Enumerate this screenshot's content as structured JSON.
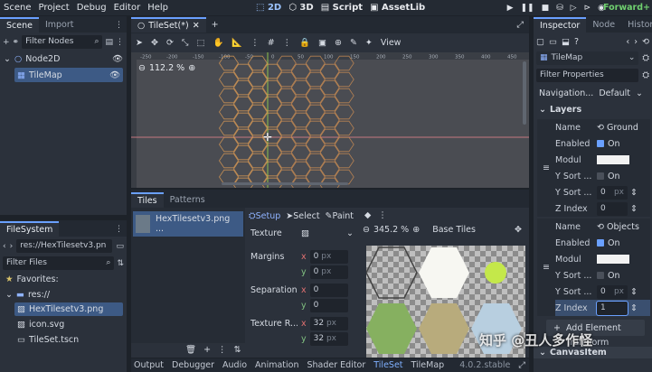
{
  "menu": [
    "Scene",
    "Project",
    "Debug",
    "Editor",
    "Help"
  ],
  "workspaces": [
    "2D",
    "3D",
    "Script",
    "AssetLib"
  ],
  "renderer": "Forward+",
  "scene_dock": {
    "tabs": [
      "Scene",
      "Import"
    ],
    "filter_placeholder": "Filter Nodes",
    "nodes": [
      "Node2D",
      "TileMap"
    ]
  },
  "filesystem": {
    "tab": "FileSystem",
    "path": "res://HexTilesetv3.pn",
    "filter_placeholder": "Filter Files",
    "favorites": "Favorites:",
    "root": "res://",
    "files": [
      "HexTilesetv3.png",
      "icon.svg",
      "TileSet.tscn"
    ]
  },
  "editor": {
    "tab": "TileSet(*)",
    "toolbar_view": "View",
    "zoom": "112.2 %",
    "ruler_labels": [
      "-250",
      "-200",
      "-150",
      "-100",
      "-50",
      "0",
      "50",
      "100",
      "150",
      "200",
      "250",
      "300",
      "350",
      "400",
      "450"
    ]
  },
  "tileset": {
    "tabs": [
      "Tiles",
      "Patterns"
    ],
    "source_name": "HexTilesetv3.png ...",
    "modes": [
      "Setup",
      "Select",
      "Paint"
    ],
    "props": {
      "texture": "Texture",
      "margins": "Margins",
      "separation": "Separation",
      "texture_region": "Texture R...",
      "x": "x",
      "y": "y",
      "px": "px",
      "margin_x": "0",
      "margin_y": "0",
      "sep_x": "0",
      "sep_y": "0",
      "region_x": "32",
      "region_y": "32"
    },
    "atlas_zoom": "345.2 %",
    "atlas_title": "Base Tiles"
  },
  "bottom_tabs": [
    "Output",
    "Debugger",
    "Audio",
    "Animation",
    "Shader Editor",
    "TileSet",
    "TileMap"
  ],
  "version": "4.0.2.stable",
  "inspector": {
    "tabs": [
      "Inspector",
      "Node",
      "History"
    ],
    "object": "TileMap",
    "filter_placeholder": "Filter Properties",
    "navigation_label": "Navigation...",
    "navigation_value": "Default",
    "section": "Layers",
    "layers": [
      {
        "name_label": "Name",
        "name": "Ground",
        "enabled_label": "Enabled",
        "enabled": "On",
        "modulate_label": "Modul",
        "ysort_label": "Y Sort ...",
        "ysort": "On",
        "ysort_origin_label": "Y Sort ...",
        "ysort_origin": "0",
        "zindex_label": "Z Index",
        "zindex": "0"
      },
      {
        "name_label": "Name",
        "name": "Objects",
        "enabled_label": "Enabled",
        "enabled": "On",
        "modulate_label": "Modul",
        "ysort_label": "Y Sort ...",
        "ysort": "On",
        "ysort_origin_label": "Y Sort ...",
        "ysort_origin": "0",
        "zindex_label": "Z Index",
        "zindex": "1"
      }
    ],
    "px": "px",
    "add_element": "Add Element",
    "transform": "Transform",
    "canvas_item": "CanvasItem"
  },
  "watermark": "知乎 @丑人多作怪",
  "colors": {
    "accent": "#6aa0ff",
    "bg": "#2b313b",
    "dark": "#1d2229"
  }
}
